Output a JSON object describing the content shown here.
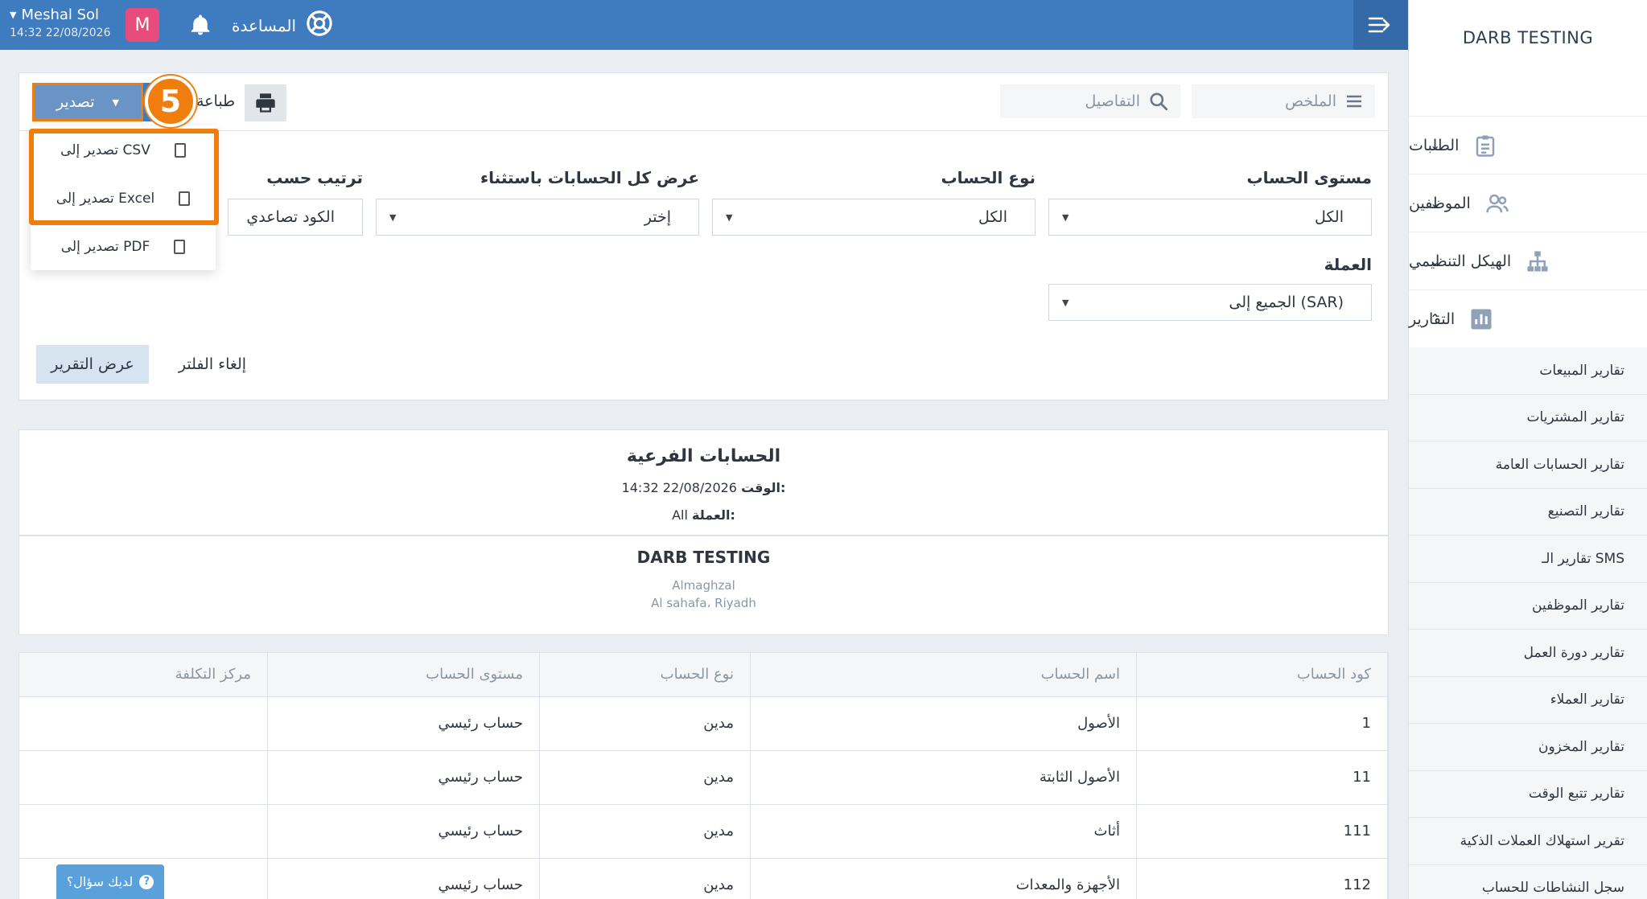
{
  "header": {
    "user_name": "Meshal Sol",
    "user_time": "14:32 22/08/2026",
    "avatar_letter": "M",
    "help_label": "المساعدة"
  },
  "sidebar": {
    "brand": "DARB TESTING",
    "items": [
      {
        "label": "الطلبات",
        "chevron": "⌄"
      },
      {
        "label": "الموظفين",
        "chevron": "⌄"
      },
      {
        "label": "الهيكل التنظيمي",
        "chevron": "⌄"
      },
      {
        "label": "التقارير",
        "chevron": "⌃"
      }
    ],
    "sub_items": [
      "تقارير المبيعات",
      "تقارير المشتريات",
      "تقارير الحسابات العامة",
      "تقارير التصنيع",
      "تقارير الـ SMS",
      "تقارير الموظفين",
      "تقارير دورة العمل",
      "تقارير العملاء",
      "تقارير المخزون",
      "تقارير تتبع الوقت",
      "تقرير استهلاك العملات الذكية",
      "سجل النشاطات للحساب"
    ]
  },
  "toolbar": {
    "summary_label": "الملخص",
    "details_label": "التفاصيل",
    "print_label": "طباعة",
    "export_label": "تصدير",
    "step_number": "5"
  },
  "export_menu": {
    "csv": "تصدير إلى CSV",
    "excel": "تصدير إلى Excel",
    "pdf": "تصدير إلى PDF"
  },
  "filters": {
    "account_level_label": "مستوى الحساب",
    "account_level_value": "الكل",
    "account_type_label": "نوع الحساب",
    "account_type_value": "الكل",
    "show_all_label": "عرض كل الحسابات باستثناء",
    "show_all_value": "إختر",
    "sort_label": "ترتيب حسب",
    "sort_value": "الكود تصاعدي",
    "currency_label": "العملة",
    "currency_value": "الجميع إلى (SAR)",
    "show_report_button": "عرض التقرير",
    "cancel_filter_button": "إلغاء الفلتر"
  },
  "report": {
    "title": "الحسابات الفرعية",
    "time_label": "الوقت:",
    "time_value": "14:32 22/08/2026",
    "currency_label": "العملة:",
    "currency_value": "All",
    "company": "DARB TESTING",
    "address_line1": "Almaghzal",
    "address_line2": "Al sahafa، Riyadh"
  },
  "table": {
    "headers": [
      "كود الحساب",
      "اسم الحساب",
      "نوع الحساب",
      "مستوى الحساب",
      "مركز التكلفة"
    ],
    "rows": [
      [
        "1",
        "الأصول",
        "مدين",
        "حساب رئيسي",
        ""
      ],
      [
        "11",
        "الأصول الثابتة",
        "مدين",
        "حساب رئيسي",
        ""
      ],
      [
        "111",
        "أثاث",
        "مدين",
        "حساب رئيسي",
        ""
      ],
      [
        "112",
        "الأجهزة والمعدات",
        "مدين",
        "حساب رئيسي",
        ""
      ]
    ]
  },
  "question_button": "لديك سؤال؟",
  "colors": {
    "topbar": "#3f7bbf",
    "highlight": "#f07e0e",
    "avatar": "#e74c7c"
  }
}
